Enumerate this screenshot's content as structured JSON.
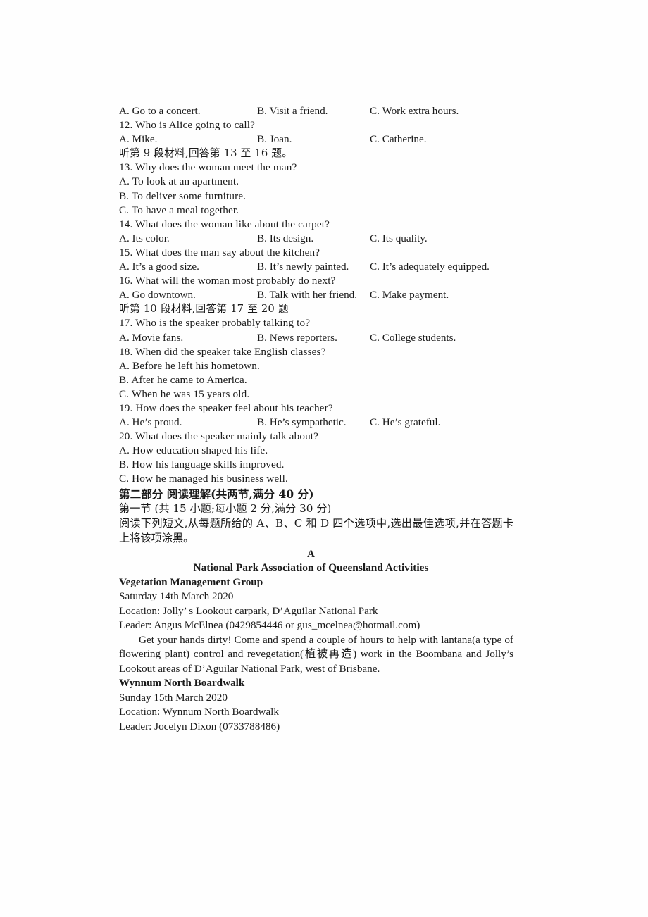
{
  "listening": {
    "q11_options": {
      "a": "A. Go to a concert.",
      "b": "B. Visit a friend.",
      "c": "C. Work extra hours."
    },
    "q12_stem": "12. Who is Alice going to call?",
    "q12_options": {
      "a": "A. Mike.",
      "b": "B. Joan.",
      "c": "C. Catherine."
    },
    "material9_note": "听第 9 段材料,回答第 13 至 16 题。",
    "q13_stem": "13. Why does the woman meet the man?",
    "q13_a": "A. To look at an apartment.",
    "q13_b": "B. To deliver some furniture.",
    "q13_c": "C. To have a meal together.",
    "q14_stem": "14. What does the woman like about the carpet?",
    "q14_options": {
      "a": "A. Its color.",
      "b": "B. Its design.",
      "c": "C. Its quality."
    },
    "q15_stem": "15. What does the man say about the kitchen?",
    "q15_options": {
      "a": "A. It’s a good size.",
      "b": "B. It’s newly painted.",
      "c": "C. It’s adequately equipped."
    },
    "q16_stem": "16. What will the woman most probably do next?",
    "q16_options": {
      "a": "A. Go downtown.",
      "b": "B. Talk with her friend.",
      "c": "C. Make payment."
    },
    "material10_note": "听第 10 段材料,回答第 17 至 20 题",
    "q17_stem": "17. Who is the speaker probably talking to?",
    "q17_options": {
      "a": "A. Movie fans.",
      "b": "B. News reporters.",
      "c": "C. College students."
    },
    "q18_stem": "18. When did the speaker take English classes?",
    "q18_a": "A. Before he left his hometown.",
    "q18_b": "B. After he came to America.",
    "q18_c": "C. When he was 15 years old.",
    "q19_stem": "19. How does the speaker feel about his teacher?",
    "q19_options": {
      "a": "A. He’s proud.",
      "b": "B. He’s sympathetic.",
      "c": "C. He’s grateful."
    },
    "q20_stem": "20. What does the speaker mainly talk about?",
    "q20_a": "A. How education shaped his life.",
    "q20_b": "B. How his language skills improved.",
    "q20_c": "C. How he managed his business well."
  },
  "part_two": {
    "heading": "第二部分  阅读理解(共两节,满分 40 分)",
    "subheading": "第一节  (共 15 小题;每小题 2 分,满分 30 分)",
    "instruction": "阅读下列短文,从每题所给的 A、B、C 和 D 四个选项中,选出最佳选项,并在答题卡上将该项涂黑。"
  },
  "passage_a": {
    "letter": "A",
    "title": "National Park Association of Queensland Activities",
    "activity1": {
      "name": "Vegetation Management Group",
      "date": "Saturday 14th March 2020",
      "location": "Location: Jolly’ s Lookout carpark, D’Aguilar National Park",
      "leader": "Leader: Angus McElnea (0429854446 or gus_mcelnea@hotmail.com)",
      "description": "Get your hands dirty! Come and spend a couple of hours to help with lantana(a type of flowering plant) control and revegetation(植被再造) work in the Boombana and Jolly’s Lookout areas of D’Aguilar National Park, west of Brisbane."
    },
    "activity2": {
      "name": "Wynnum North Boardwalk",
      "date": "Sunday 15th March 2020",
      "location": "Location: Wynnum North Boardwalk",
      "leader": "Leader: Jocelyn Dixon (0733788486)"
    }
  }
}
